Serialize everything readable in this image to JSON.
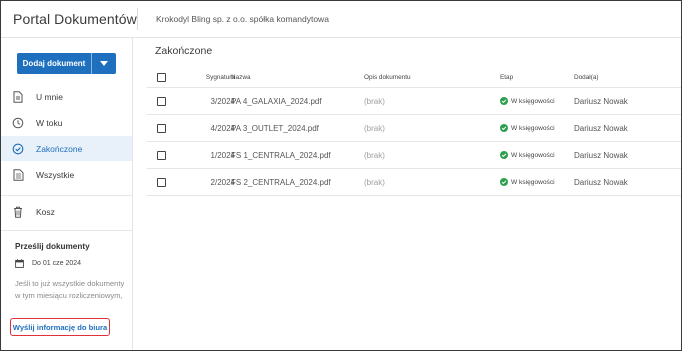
{
  "app": {
    "title": "Portal Dokumentów",
    "company": "Krokodyl Bling sp. z o.o. spółka komandytowa"
  },
  "sidebar": {
    "add_label": "Dodaj dokument",
    "items": [
      {
        "label": "U mnie",
        "icon": "document-icon"
      },
      {
        "label": "W toku",
        "icon": "clock-icon"
      },
      {
        "label": "Zakończone",
        "icon": "check-circle-icon",
        "active": true
      },
      {
        "label": "Wszystkie",
        "icon": "documents-icon"
      },
      {
        "label": "Kosz",
        "icon": "trash-icon"
      }
    ],
    "send": {
      "title": "Prześlij dokumenty",
      "deadline": "Do 01 cze 2024",
      "description": "Jeśli to już wszystkie dokumenty w tym miesiącu rozliczeniowym,",
      "link": "Wyślij informację do biura"
    }
  },
  "main": {
    "title": "Zakończone",
    "columns": {
      "signature": "Sygnatura",
      "name": "Nazwa",
      "description": "Opis dokumentu",
      "stage": "Etap",
      "added_by": "Dodał(a)"
    },
    "rows": [
      {
        "signature": "3/2024",
        "name": "PA 4_GALAXIA_2024.pdf",
        "description": "(brak)",
        "stage": "W księgowości",
        "added_by": "Dariusz Nowak"
      },
      {
        "signature": "4/2024",
        "name": "PA 3_OUTLET_2024.pdf",
        "description": "(brak)",
        "stage": "W księgowości",
        "added_by": "Dariusz Nowak"
      },
      {
        "signature": "1/2024",
        "name": "FS 1_CENTRALA_2024.pdf",
        "description": "(brak)",
        "stage": "W księgowości",
        "added_by": "Dariusz Nowak"
      },
      {
        "signature": "2/2024",
        "name": "FS 2_CENTRALA_2024.pdf",
        "description": "(brak)",
        "stage": "W księgowości",
        "added_by": "Dariusz Nowak"
      }
    ]
  },
  "colors": {
    "accent": "#1e6fbd",
    "active_bg": "#e8f1fa",
    "success": "#2e9e4f",
    "highlight": "#e0303a"
  }
}
